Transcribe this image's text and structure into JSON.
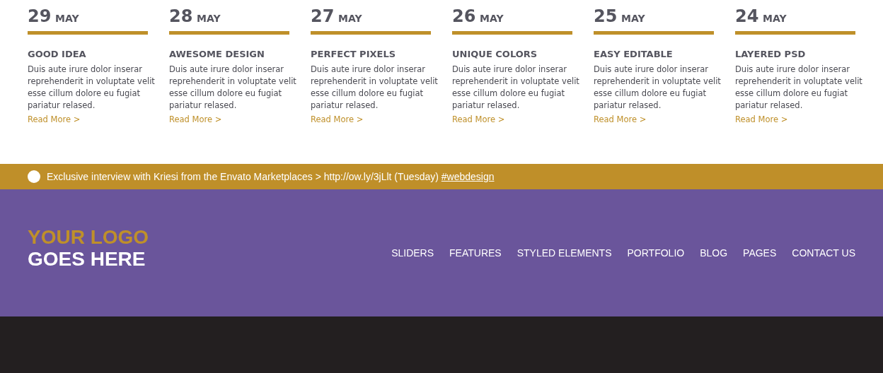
{
  "posts": [
    {
      "day": "29",
      "month": "MAY",
      "title": "GOOD IDEA",
      "body": "Duis aute irure dolor inserar reprehenderit in voluptate velit esse cillum dolore eu fugiat pariatur relased.",
      "link": "Read More >"
    },
    {
      "day": "28",
      "month": "MAY",
      "title": "AWESOME DESIGN",
      "body": "Duis aute irure dolor inserar reprehenderit in voluptate velit esse cillum dolore eu fugiat pariatur relased.",
      "link": "Read More >"
    },
    {
      "day": "27",
      "month": "MAY",
      "title": "PERFECT PIXELS",
      "body": "Duis aute irure dolor inserar reprehenderit in voluptate velit esse cillum dolore eu fugiat pariatur relased.",
      "link": "Read More >"
    },
    {
      "day": "26",
      "month": "MAY",
      "title": "UNIQUE COLORS",
      "body": "Duis aute irure dolor inserar reprehenderit in voluptate velit esse cillum dolore eu fugiat pariatur relased.",
      "link": "Read More >"
    },
    {
      "day": "25",
      "month": "MAY",
      "title": "EASY EDITABLE",
      "body": "Duis aute irure dolor inserar reprehenderit in voluptate velit esse cillum dolore eu fugiat pariatur relased.",
      "link": "Read More >"
    },
    {
      "day": "24",
      "month": "MAY",
      "title": "LAYERED PSD",
      "body": "Duis aute irure dolor inserar reprehenderit in voluptate velit esse cillum dolore eu fugiat pariatur relased.",
      "link": "Read More >"
    }
  ],
  "ticker": {
    "text": "Exclusive interview with Kriesi from the Envato Marketplaces > http://ow.ly/3jLlt (Tuesday)",
    "hashtag": "#webdesign"
  },
  "header": {
    "logo_line_1": "YOUR LOGO",
    "logo_line_2": "GOES HERE",
    "nav": [
      "SLIDERS",
      "FEATURES",
      "STYLED ELEMENTS",
      "PORTFOLIO",
      "BLOG",
      "PAGES",
      "CONTACT US"
    ]
  }
}
